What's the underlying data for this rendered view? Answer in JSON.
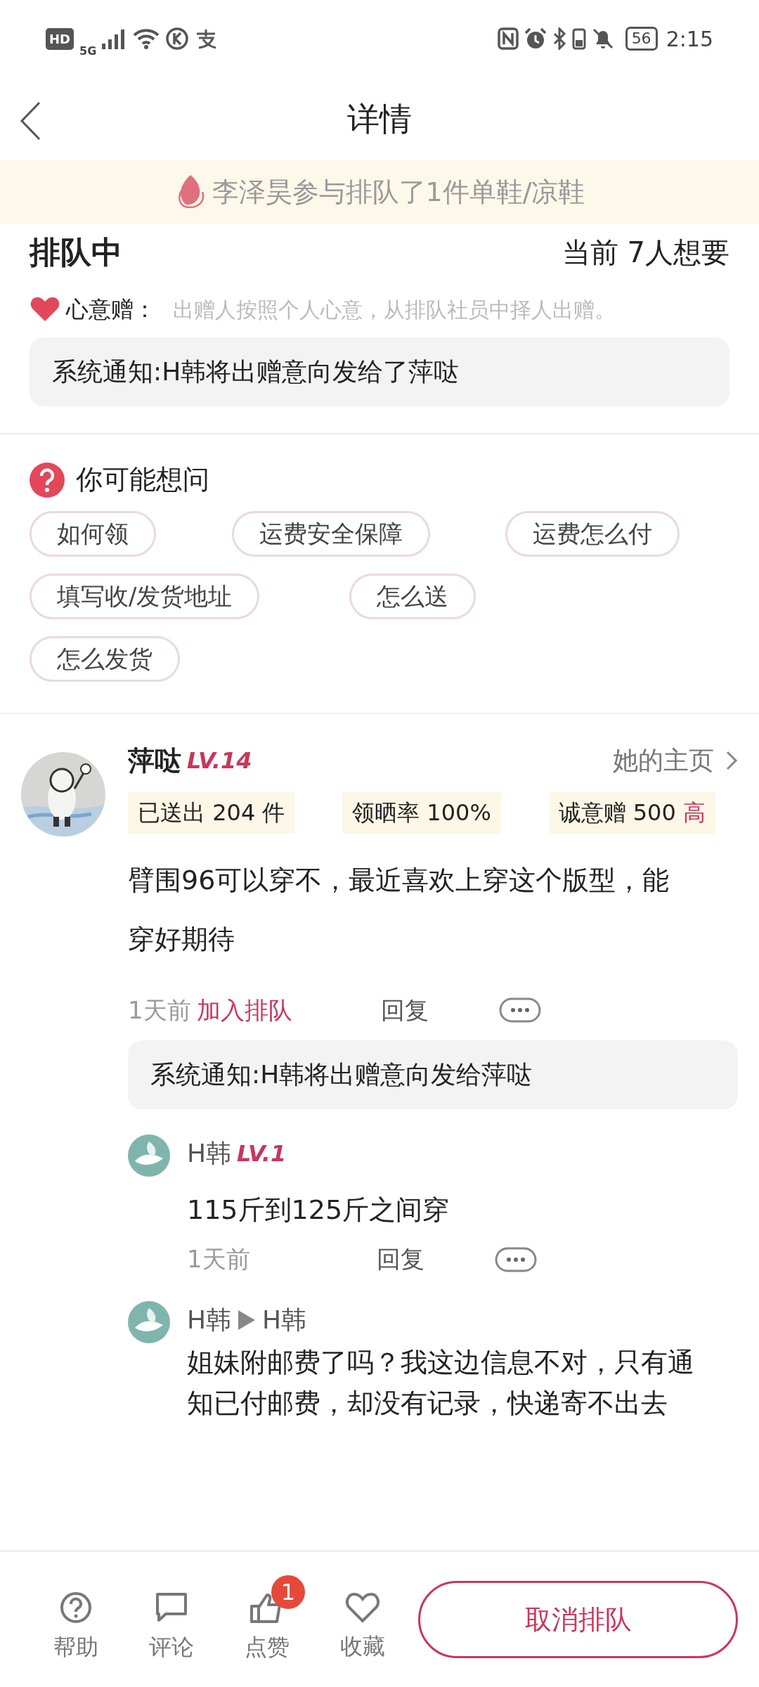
{
  "status_bar": {
    "left_labels": [
      "HD",
      "5G"
    ],
    "battery": "56",
    "time": "2:15"
  },
  "nav": {
    "title": "详情"
  },
  "banner": {
    "text": "李泽昊参与排队了1件单鞋/凉鞋"
  },
  "queue": {
    "status": "排队中",
    "wanting": "当前 7人想要",
    "gift_label": "心意赠：",
    "gift_desc": "出赠人按照个人心意，从排队社员中择人出赠。",
    "notice": "系统通知:H韩将出赠意向发给了萍哒"
  },
  "faq": {
    "title": "你可能想问",
    "tags": [
      [
        "如何领",
        "运费安全保障",
        "运费怎么付"
      ],
      [
        "填写收/发货地址",
        "怎么送"
      ],
      [
        "怎么发货"
      ]
    ]
  },
  "comment": {
    "user": "萍哒",
    "level": "LV.14",
    "homepage": "她的主页",
    "stats": [
      {
        "text": "已送出 204 件"
      },
      {
        "text": "领晒率 100%"
      },
      {
        "text": "诚意赠 500",
        "highlight": "高"
      }
    ],
    "text": "臂围96可以穿不，最近喜欢上穿这个版型，能穿好期待",
    "time": "1天前",
    "action": "加入排队",
    "reply": "回复",
    "notice": "系统通知:H韩将出赠意向发给萍哒",
    "replies": [
      {
        "user": "H韩",
        "level": "LV.1",
        "text": "115斤到125斤之间穿",
        "time": "1天前",
        "reply": "回复"
      },
      {
        "user": "H韩",
        "to": "H韩",
        "text": "姐妹附邮费了吗？我这边信息不对，只有通知已付邮费，却没有记录，快递寄不出去"
      }
    ]
  },
  "bottom_bar": {
    "actions": [
      {
        "kind": "help",
        "label": "帮助"
      },
      {
        "kind": "comment",
        "label": "评论"
      },
      {
        "kind": "like",
        "label": "点赞",
        "badge": "1"
      },
      {
        "kind": "favorite",
        "label": "收藏"
      }
    ],
    "primary_button": "取消排队"
  }
}
